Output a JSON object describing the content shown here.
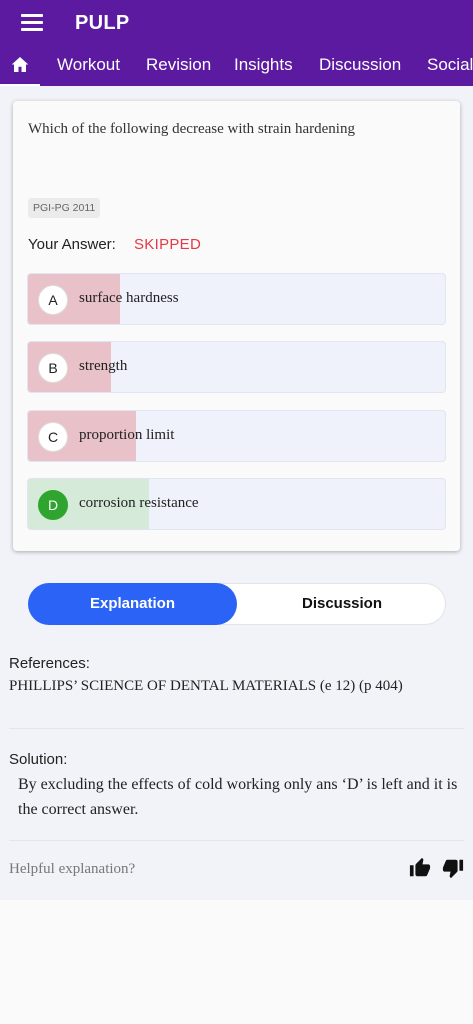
{
  "app": {
    "title": "PULP"
  },
  "nav": {
    "tabs": [
      {
        "label": "Workout"
      },
      {
        "label": "Revision"
      },
      {
        "label": "Insights"
      },
      {
        "label": "Discussion"
      },
      {
        "label": "Social"
      }
    ]
  },
  "question": {
    "text": "Which of the following decrease with strain hardening",
    "tag": "PGI-PG 2011",
    "answer_label": "Your Answer:",
    "answer_value": "SKIPPED",
    "options": [
      {
        "letter": "A",
        "text": "surface hardness",
        "percent": 22,
        "status": "wrong"
      },
      {
        "letter": "B",
        "text": "strength",
        "percent": 20,
        "status": "wrong"
      },
      {
        "letter": "C",
        "text": "proportion limit",
        "percent": 26,
        "status": "wrong"
      },
      {
        "letter": "D",
        "text": "corrosion resistance",
        "percent": 29,
        "status": "correct"
      }
    ]
  },
  "toggle": {
    "explanation_label": "Explanation",
    "discussion_label": "Discussion"
  },
  "references": {
    "label": "References:",
    "text": "PHILLIPS’ SCIENCE OF DENTAL MATERIALS (e 12) (p 404)"
  },
  "solution": {
    "label": "Solution:",
    "text": "By excluding the effects of cold working only ans ‘D’ is left and it is the correct answer."
  },
  "feedback": {
    "prompt": "Helpful explanation?"
  },
  "colors": {
    "appbar": "#5b1aa0",
    "accent": "#2a63f5",
    "skipped": "#e53945",
    "wrong_fill": "#e9c2c9",
    "correct_fill": "#d5ead8",
    "correct_badge": "#2fa52f"
  },
  "icons": {
    "menu": "hamburger-icon",
    "home": "home-icon",
    "like": "thumbs-up-icon",
    "dislike": "thumbs-down-icon"
  }
}
